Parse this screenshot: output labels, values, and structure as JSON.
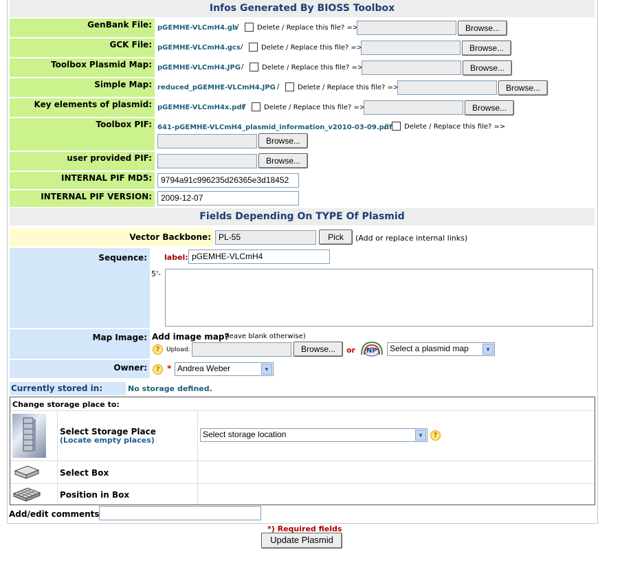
{
  "toolbox": {
    "title": "Infos Generated By BIOSS Toolbox",
    "delete_replace_label": "Delete / Replace this file? =>",
    "browse_label": "Browse...",
    "files": [
      {
        "label": "GenBank File:",
        "filename": "pGEMHE-VLCmH4.gb"
      },
      {
        "label": "GCK File:",
        "filename": "pGEMHE-VLCmH4.gcs"
      },
      {
        "label": "Toolbox Plasmid Map:",
        "filename": "pGEMHE-VLCmH4.JPG"
      },
      {
        "label": "Simple Map:",
        "filename": "reduced_pGEMHE-VLCmH4.JPG"
      },
      {
        "label": "Key elements of plasmid:",
        "filename": "pGEMHE-VLCmH4x.pdf"
      },
      {
        "label": "Toolbox PIF:",
        "filename": "641-pGEMHE-VLCmH4_plasmid_information_v2010-03-09.pdf"
      }
    ],
    "user_pif_label": "user provided PIF:",
    "md5_label": "INTERNAL PIF MD5:",
    "md5_value": "9794a91c996235d26365e3d18452",
    "version_label": "INTERNAL PIF VERSION:",
    "version_value": "2009-12-07",
    "separator": "/"
  },
  "type_fields": {
    "title": "Fields Depending On TYPE Of Plasmid",
    "vector_backbone_label": "Vector Backbone:",
    "vector_backbone_value": "PL-55",
    "pick_label": "Pick",
    "pick_hint": "(Add or replace internal links)",
    "sequence_label": "Sequence:",
    "seq_label_prefix": "label:",
    "seq_label_value": "pGEMHE-VLCmH4",
    "five_prime": "5'-",
    "map_image_label": "Map Image:",
    "add_image_map": "Add image map?",
    "leave_blank": "(leave blank otherwise)",
    "upload_label": "Upload:",
    "or_label": "or",
    "np_logo": "NP",
    "select_map_value": "Select a plasmid map",
    "owner_label": "Owner:",
    "required_star": "*",
    "owner_value": "Andrea Weber",
    "help_glyph": "?"
  },
  "storage": {
    "currently_stored_label": "Currently stored in:",
    "currently_stored_value": "No storage defined.",
    "change_label": "Change storage place to:",
    "select_place_label": "Select Storage Place",
    "locate_empty": "(Locate empty places)",
    "select_location_value": "Select storage location",
    "select_box_label": "Select Box",
    "position_label": "Position in Box"
  },
  "comments": {
    "label": "Add/edit comments:",
    "value": ""
  },
  "footer": {
    "required_note": "*) Required fields",
    "submit_label": "Update Plasmid"
  },
  "colors": {
    "green_label_bg": "#ccf28e",
    "yellow_label_bg": "#fffccf",
    "blue_label_bg": "#d4e6fa",
    "heading_text": "#1c3f73",
    "filename_text": "#1c5f7a",
    "required_red": "#cc0000"
  }
}
